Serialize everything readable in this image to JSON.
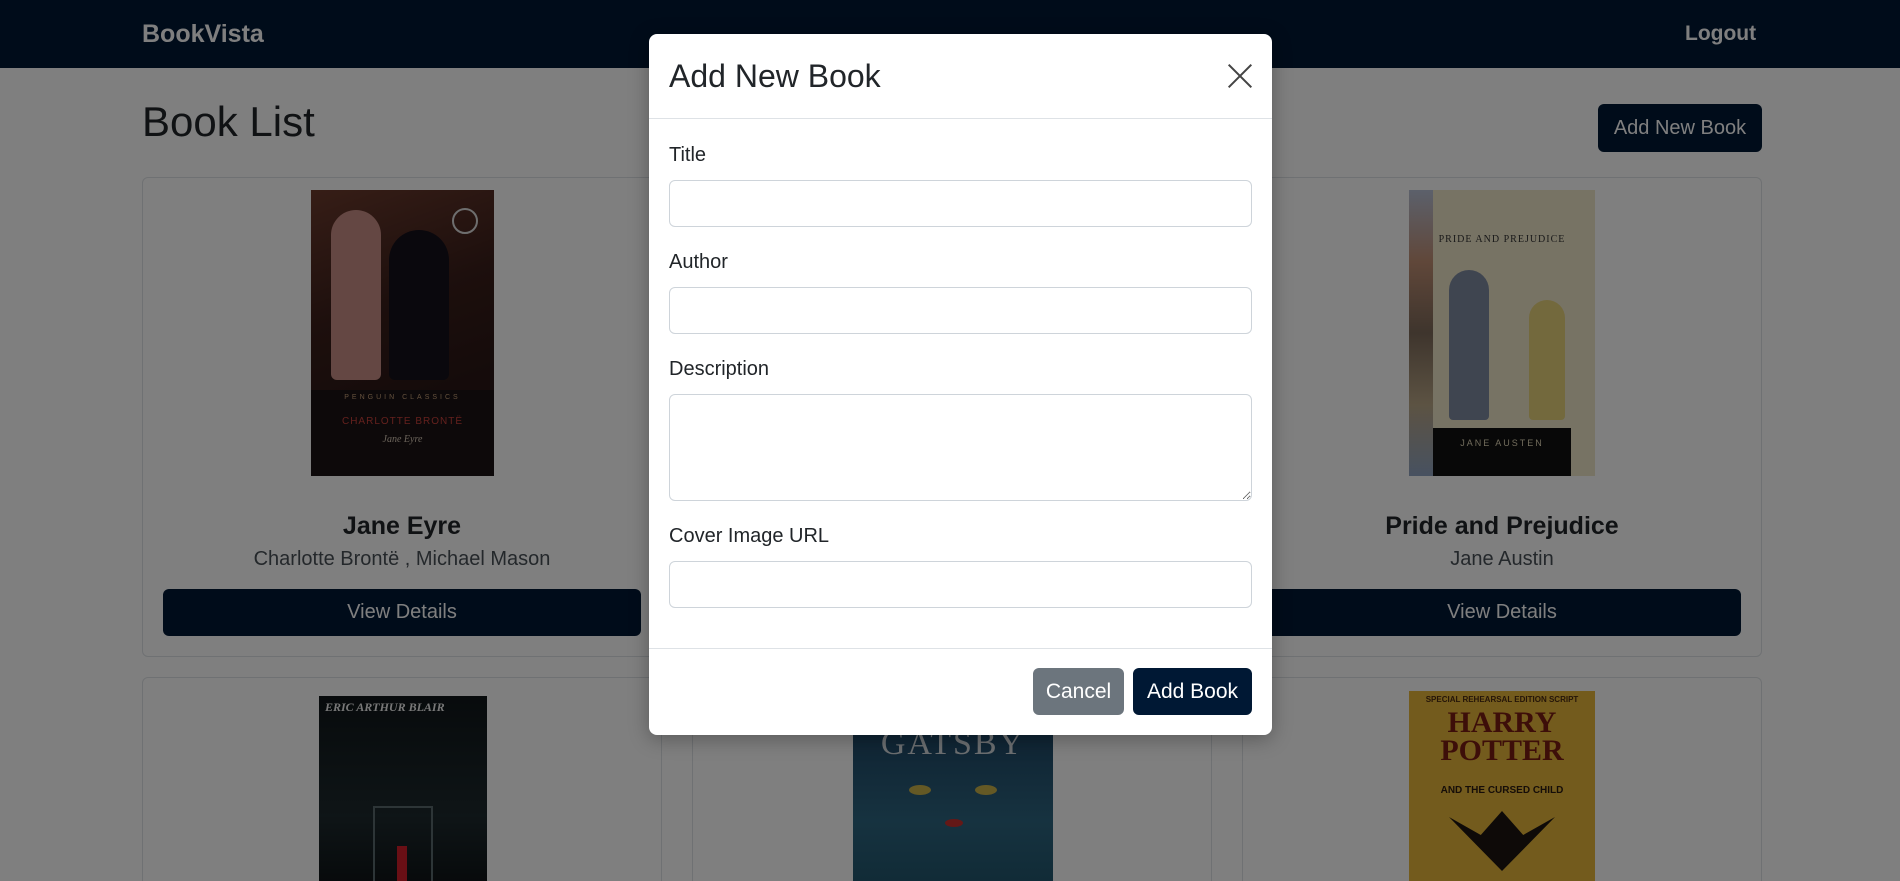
{
  "navbar": {
    "brand": "BookVista",
    "logout": "Logout"
  },
  "page": {
    "title": "Book List",
    "add_button": "Add New Book"
  },
  "books": [
    {
      "title": "Jane Eyre",
      "author": "Charlotte Brontë , Michael Mason",
      "button": "View Details",
      "cover": {
        "series": "PENGUIN CLASSICS",
        "author": "CHARLOTTE BRONTË",
        "title": "Jane Eyre"
      }
    },
    {
      "title": "Pride and Prejudice",
      "author": "Jane Austin",
      "button": "View Details",
      "cover": {
        "title": "PRIDE AND PREJUDICE",
        "author": "JANE AUSTEN"
      }
    },
    {
      "cover": {
        "author": "ERIC ARTHUR BLAIR"
      }
    },
    {
      "cover": {
        "title": "GATSBY"
      }
    },
    {
      "cover": {
        "edition": "SPECIAL REHEARSAL EDITION SCRIPT",
        "title": "HARRY POTTER",
        "subtitle": "AND THE CURSED CHILD"
      }
    }
  ],
  "modal": {
    "title": "Add New Book",
    "fields": {
      "title_label": "Title",
      "author_label": "Author",
      "description_label": "Description",
      "cover_label": "Cover Image URL"
    },
    "values": {
      "title": "",
      "author": "",
      "description": "",
      "cover": ""
    },
    "cancel": "Cancel",
    "submit": "Add Book"
  },
  "colors": {
    "navbar": "#001834",
    "primary": "#001834",
    "secondary": "#6c757d"
  }
}
